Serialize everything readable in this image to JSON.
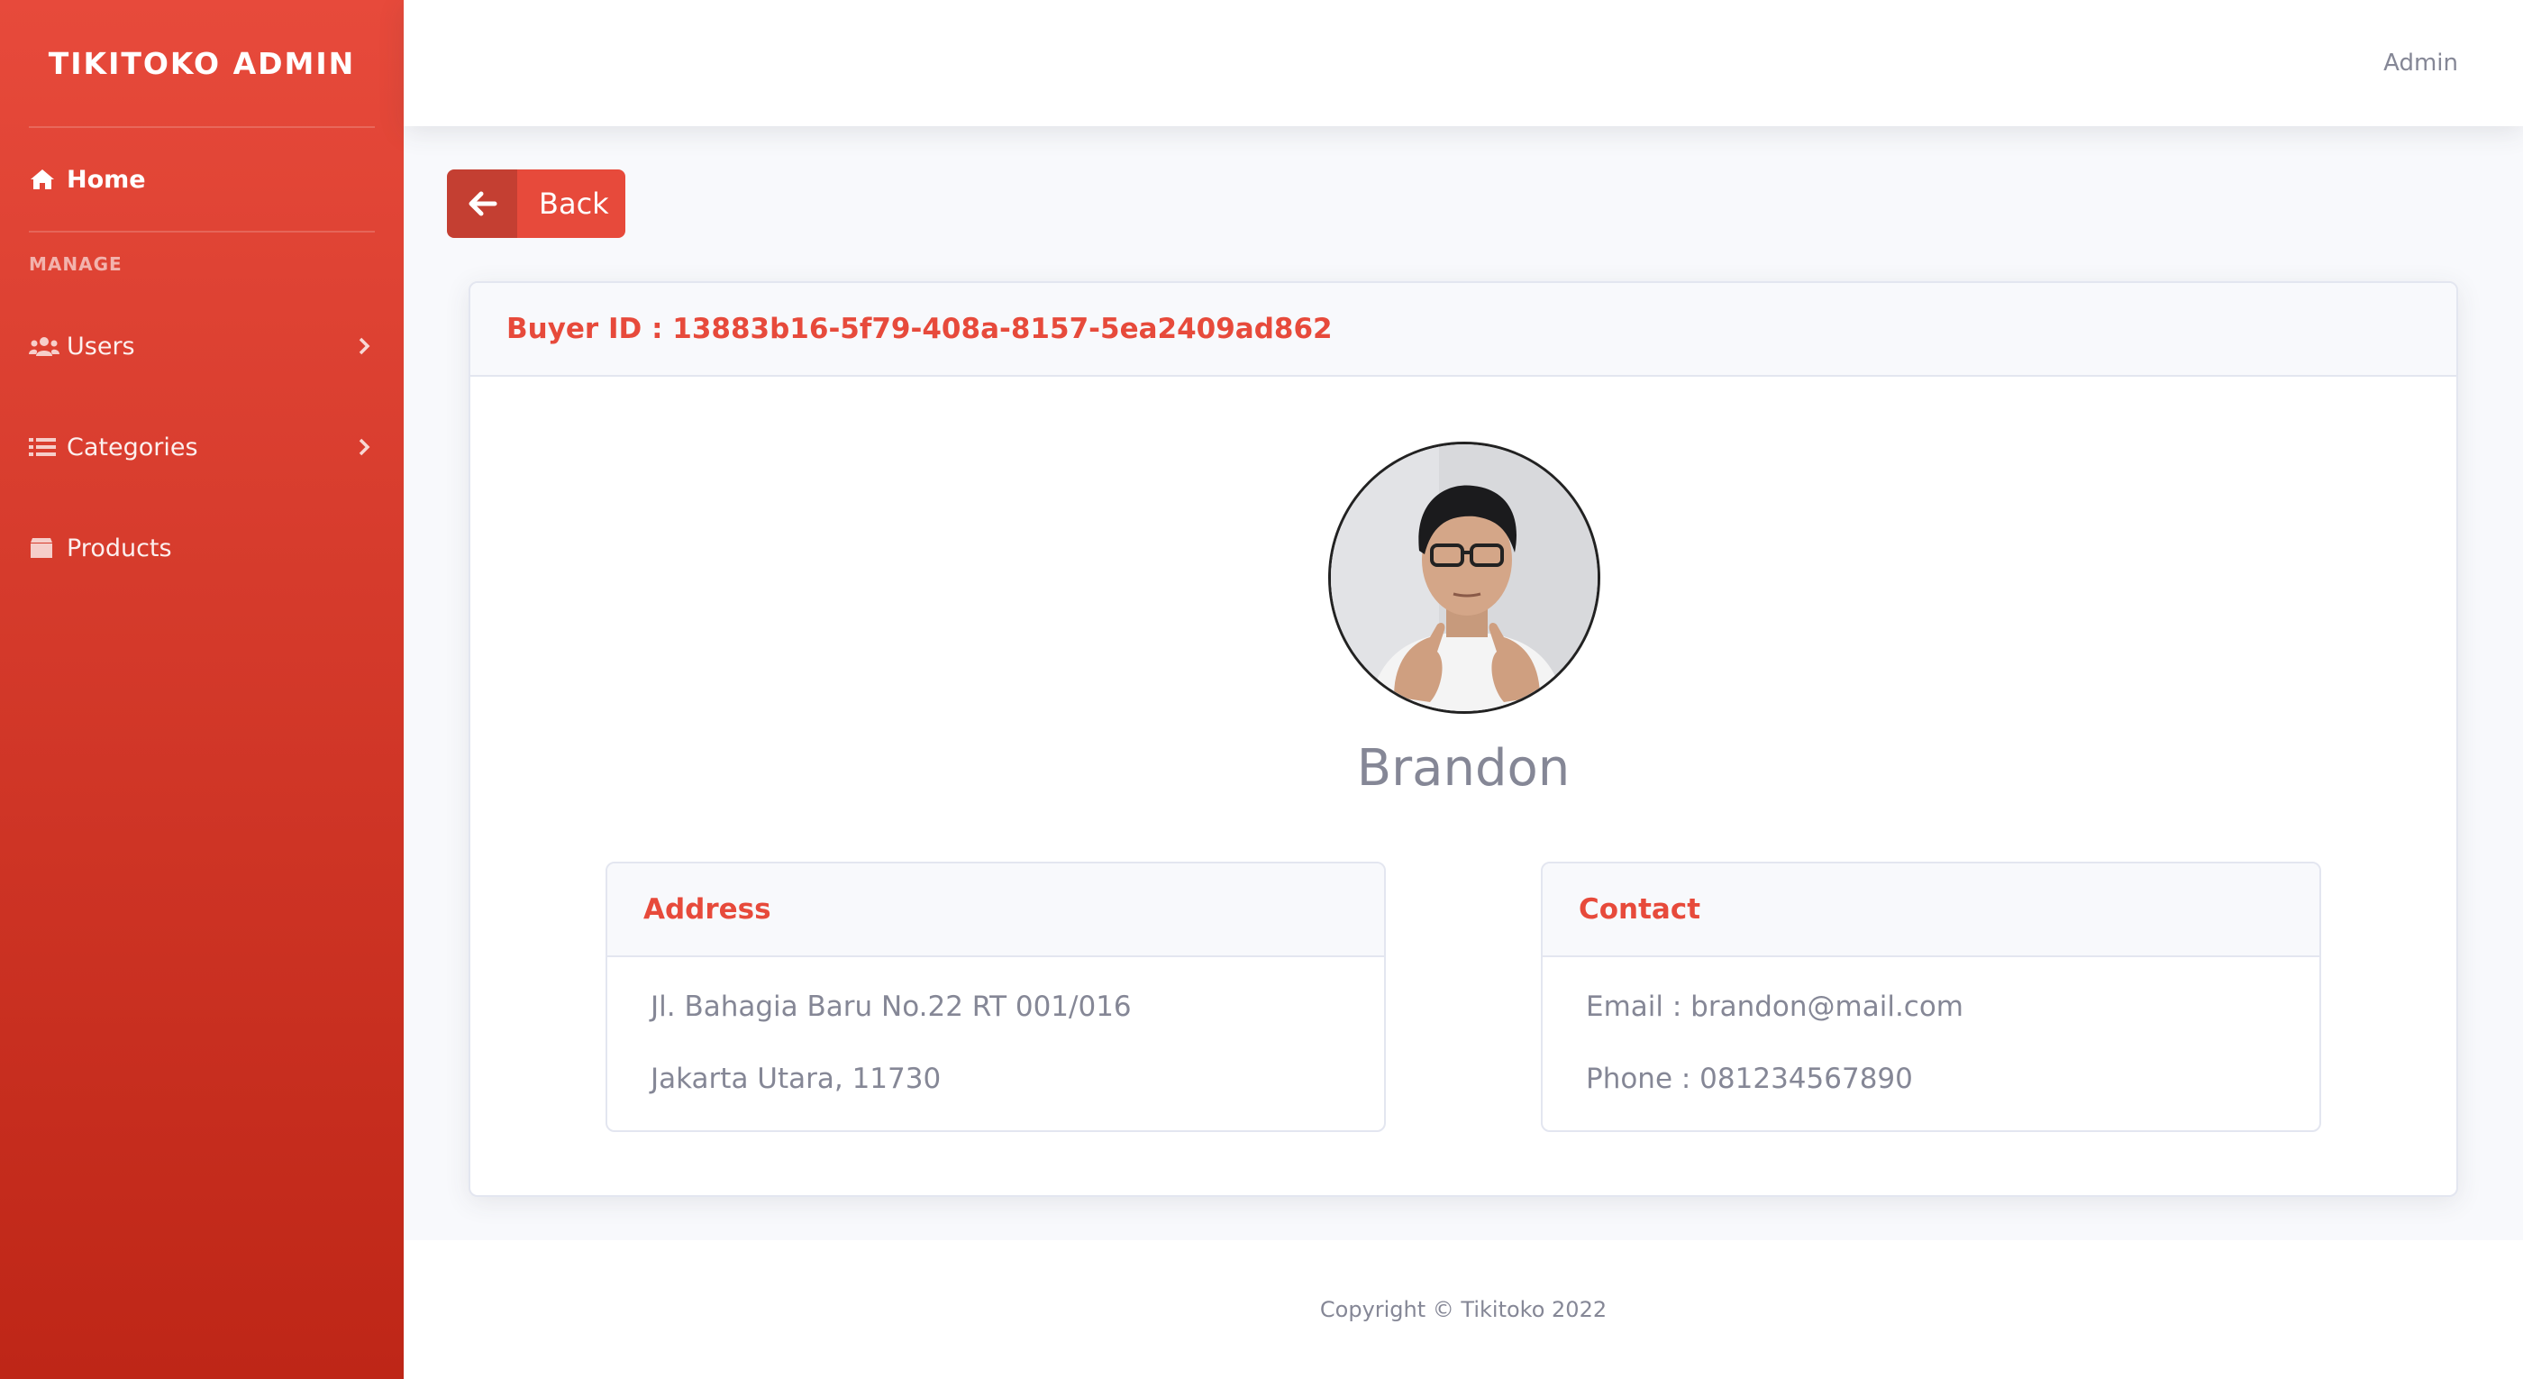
{
  "sidebar": {
    "brand": "TIKITOKO ADMIN",
    "home_label": "Home",
    "manage_heading": "MANAGE",
    "items": [
      {
        "label": "Users",
        "icon": "users-icon"
      },
      {
        "label": "Categories",
        "icon": "list-icon"
      },
      {
        "label": "Products",
        "icon": "box-icon"
      }
    ]
  },
  "topbar": {
    "user": "Admin"
  },
  "back_button": {
    "label": "Back"
  },
  "buyer": {
    "header": "Buyer ID : 13883b16-5f79-408a-8157-5ea2409ad862",
    "name": "Brandon",
    "address": {
      "title": "Address",
      "line1": "Jl. Bahagia Baru No.22 RT 001/016",
      "line2": "Jakarta Utara, 11730"
    },
    "contact": {
      "title": "Contact",
      "email": "Email : brandon@mail.com",
      "phone": "Phone : 081234567890"
    }
  },
  "footer": {
    "text": "Copyright © Tikitoko 2022"
  },
  "colors": {
    "accent": "#e74a3b",
    "accent_dark": "#be2617",
    "text_muted": "#858796",
    "background": "#f8f9fc"
  }
}
